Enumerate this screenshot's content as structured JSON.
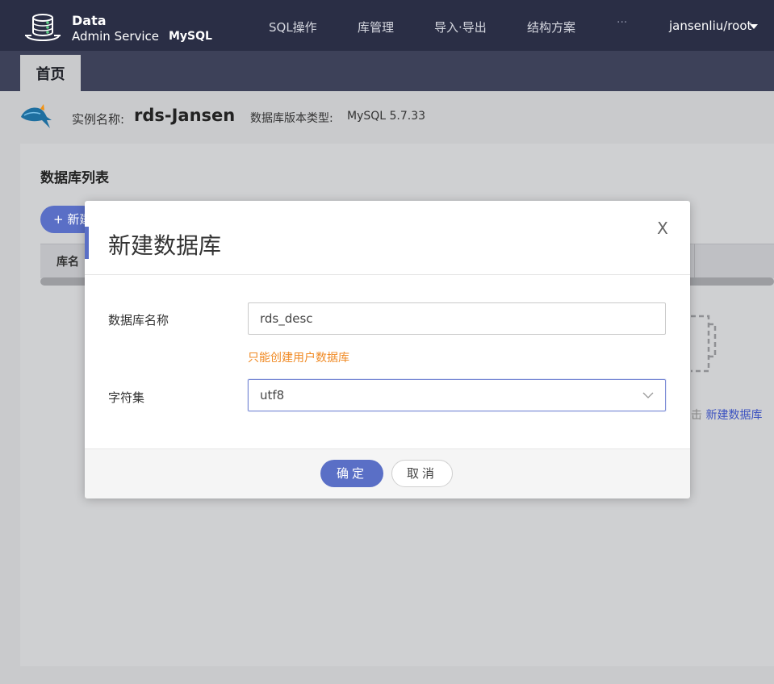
{
  "header": {
    "brand_line1": "Data",
    "brand_line2": "Admin Service",
    "brand_db": "MySQL",
    "nav": [
      "SQL操作",
      "库管理",
      "导入·导出",
      "结构方案"
    ],
    "more": "···",
    "user": "jansenliu/root"
  },
  "tabs": {
    "home": "首页"
  },
  "instance": {
    "name_label": "实例名称:",
    "name": "rds-Jansen",
    "version_label": "数据库版本类型:",
    "version": "MySQL 5.7.33"
  },
  "db_list": {
    "title": "数据库列表",
    "new_button": "+ 新建数据库",
    "column_name": "库名",
    "empty_hint_prefix": "点击",
    "empty_hint_link": "新建数据库"
  },
  "modal": {
    "title": "新建数据库",
    "close": "X",
    "name_label": "数据库名称",
    "name_value": "rds_desc",
    "name_hint": "只能创建用户数据库",
    "charset_label": "字符集",
    "charset_value": "utf8",
    "ok": "确定",
    "cancel": "取消"
  },
  "colors": {
    "accent": "#5a6fc6",
    "header_bg": "#2a2e45",
    "warning": "#f08a24"
  }
}
